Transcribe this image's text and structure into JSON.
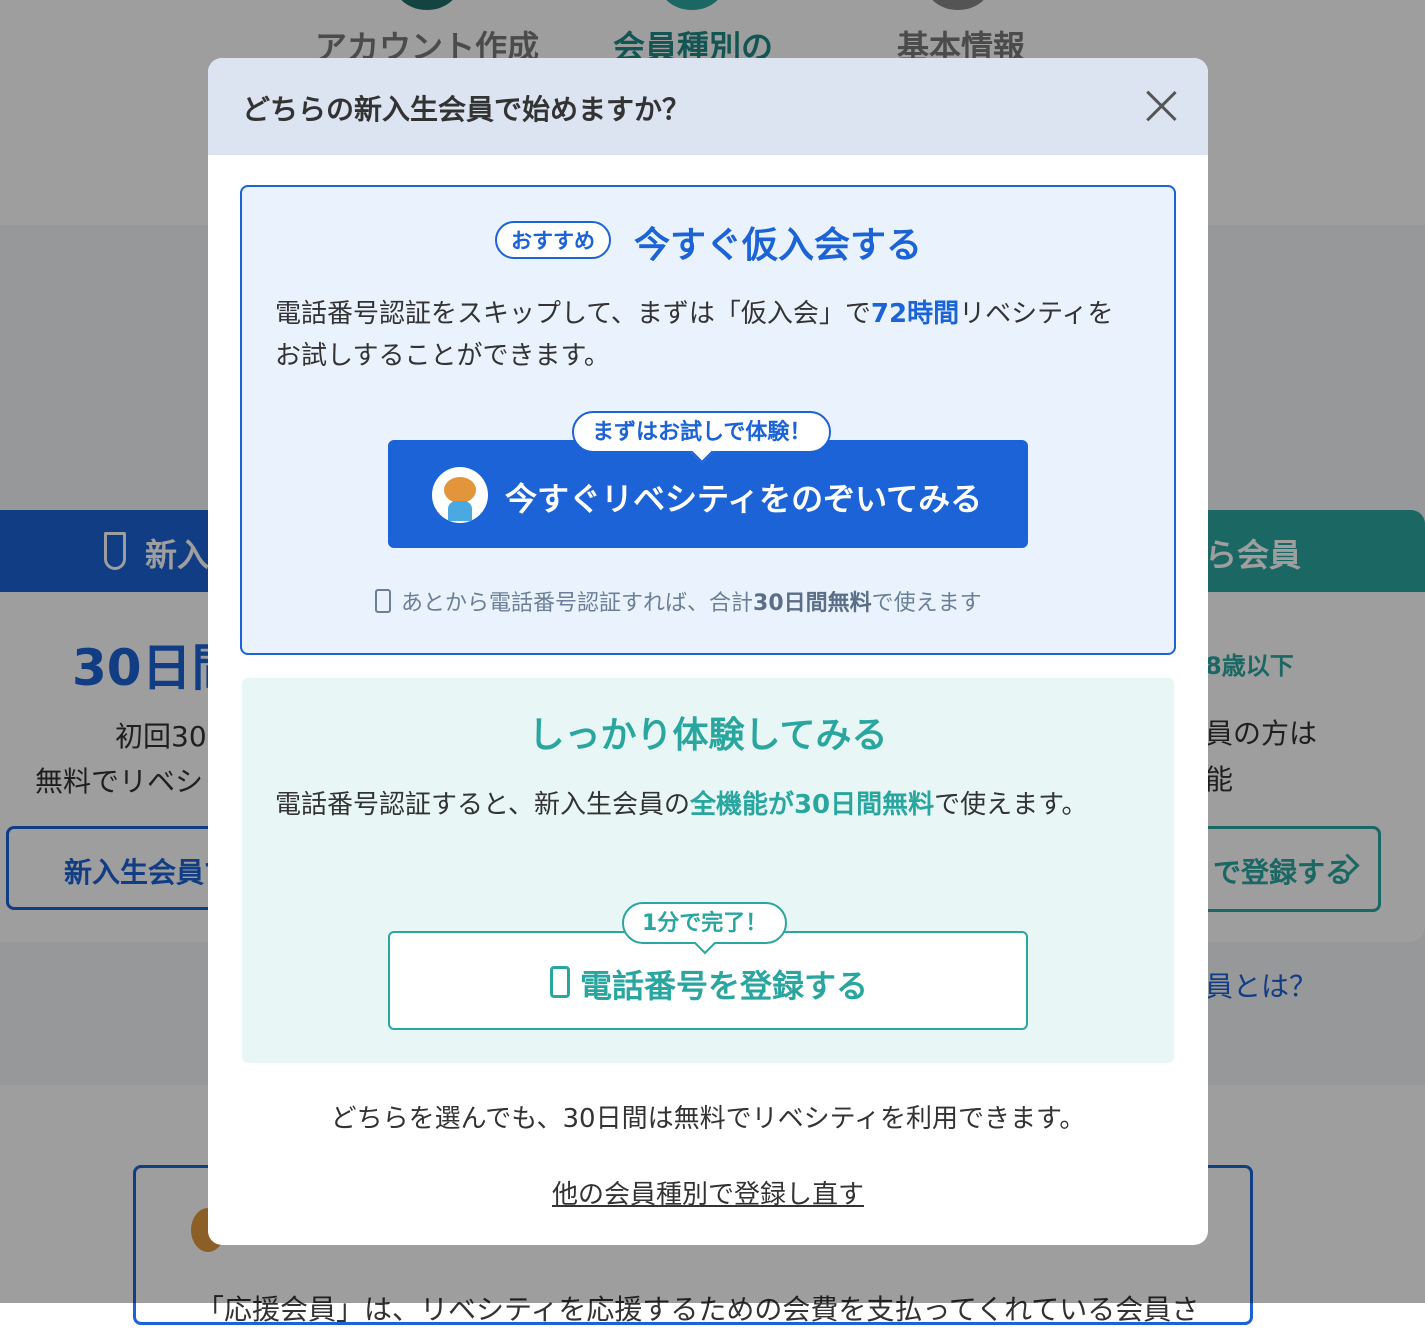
{
  "background": {
    "steps": [
      {
        "label": "アカウント作成",
        "color": "#1f6e6b"
      },
      {
        "label": "会員種別の",
        "color": "#2aa6a0"
      },
      {
        "label": "基本情報",
        "color": "#888888"
      }
    ],
    "left_card": {
      "header": "新入",
      "big_text": "30日間",
      "line1": "初回30",
      "line2": "無料でリベシ",
      "button_label": "新入生会員で"
    },
    "right_card": {
      "header": "ら会員",
      "age": "8歳以下",
      "line1": "員の方は",
      "line2": "能",
      "button_label": "で登録する"
    },
    "what_link": "員とは？",
    "bottom_text": "「応援会員」は、リベシティを応援するための会費を支払ってくれている会員さ"
  },
  "modal": {
    "title": "どちらの新入生会員で始めますか？",
    "close_icon": "close-icon",
    "option_quick": {
      "badge": "おすすめ",
      "title": "今すぐ仮入会する",
      "desc_pre": "電話番号認証をスキップして、まずは「仮入会」で",
      "desc_highlight": "72時間",
      "desc_post": "リベシティをお試しすることができます。",
      "bubble": "まずはお試しで体験！",
      "button_label": "今すぐリベシティをのぞいてみる",
      "note_pre": "あとから電話番号認証すれば、合計",
      "note_bold": "30日間無料",
      "note_post": "で使えます"
    },
    "option_full": {
      "title": "しっかり体験してみる",
      "desc_pre": "電話番号認証すると、新入生会員の",
      "desc_highlight": "全機能が30日間無料",
      "desc_post": "で使えます。",
      "bubble": "1分で完了！",
      "button_label": "電話番号を登録する"
    },
    "footer_note": "どちらを選んでも、30日間は無料でリベシティを利用できます。",
    "re_register_link": "他の会員種別で登録し直す"
  },
  "colors": {
    "primary_blue": "#1b63d6",
    "teal": "#2aa6a0",
    "header_bg": "#dce4f2",
    "option_quick_bg": "#eaf3fd",
    "option_full_bg": "#e8f7f5"
  }
}
